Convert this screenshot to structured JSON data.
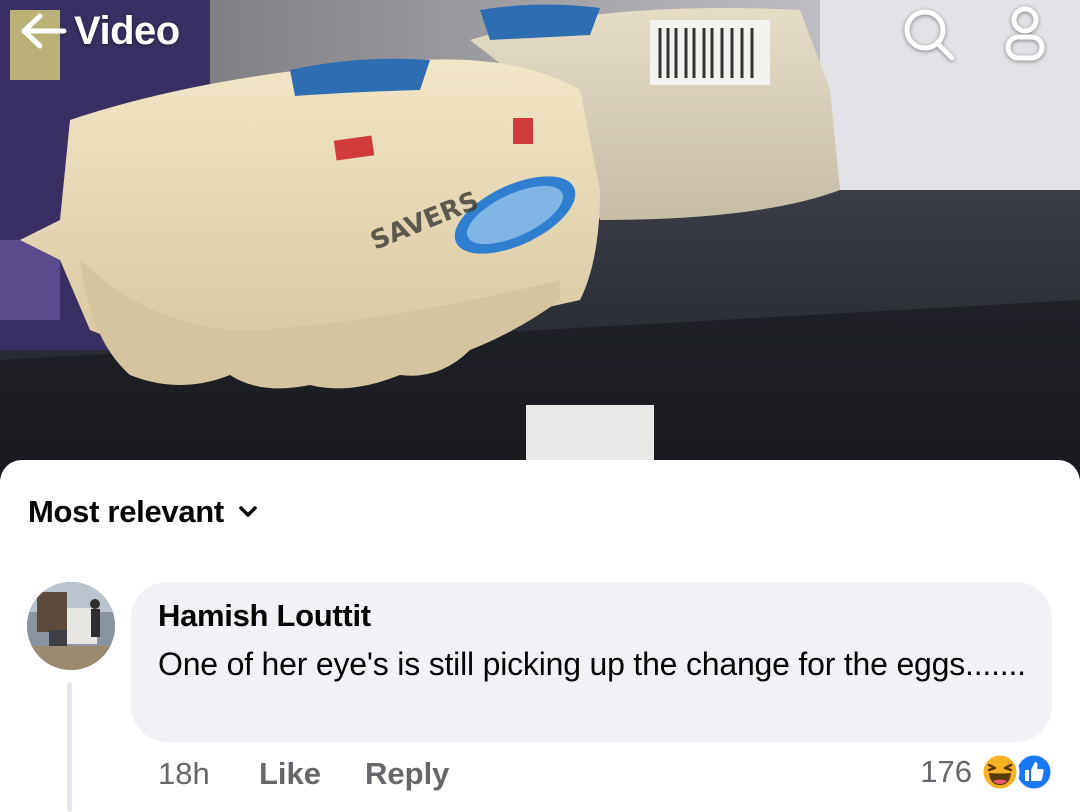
{
  "header": {
    "back_label": "Video",
    "icons": [
      "back-arrow-icon",
      "search-icon",
      "profile-icon"
    ]
  },
  "video": {
    "carton_brand_text": "SAVERS"
  },
  "comments_sheet": {
    "sort_label": "Most relevant",
    "sort_icon": "chevron-down-icon",
    "comments": [
      {
        "author": "Hamish Louttit",
        "text": "One of her eye's is still picking up the change for the eggs.......",
        "time": "18h",
        "like_label": "Like",
        "reply_label": "Reply",
        "reaction_count": "176",
        "reaction_icons": [
          "haha-reaction-icon",
          "like-reaction-icon"
        ]
      }
    ]
  },
  "colors": {
    "link_blue": "#1877f2",
    "bubble_bg": "#f0f2f5",
    "meta_text": "#65676b",
    "haha_yellow": "#f7b125"
  }
}
